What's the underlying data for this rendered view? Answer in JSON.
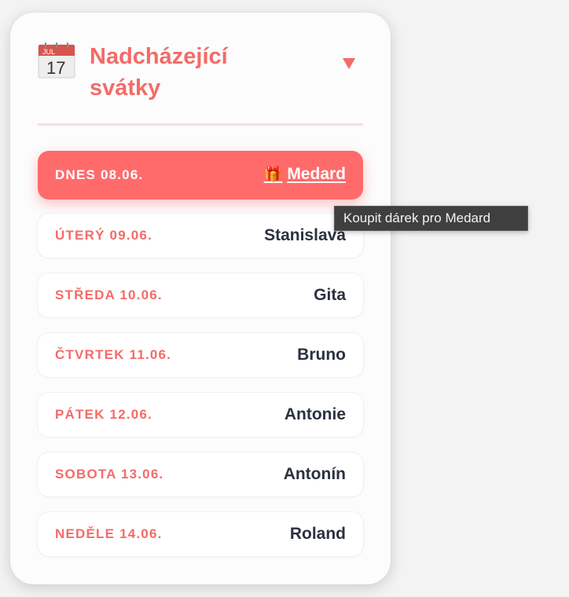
{
  "widget": {
    "title": "Nadcházející svátky",
    "calendar_icon": {
      "name": "calendar-icon",
      "month": "JUL",
      "day": "17"
    },
    "toggle_icon": "triangle-down-icon",
    "accent_color": "#ff6b6b"
  },
  "today": {
    "date": "DNES 08.06.",
    "gift_icon": "🎁",
    "name": "Medard"
  },
  "days": [
    {
      "date": "ÚTERÝ 09.06.",
      "name": "Stanislava"
    },
    {
      "date": "STŘEDA 10.06.",
      "name": "Gita"
    },
    {
      "date": "ČTVRTEK 11.06.",
      "name": "Bruno"
    },
    {
      "date": "PÁTEK 12.06.",
      "name": "Antonie"
    },
    {
      "date": "SOBOTA 13.06.",
      "name": "Antonín"
    },
    {
      "date": "NEDĚLE 14.06.",
      "name": "Roland"
    }
  ],
  "tooltip": {
    "text": "Koupit dárek pro Medard"
  }
}
